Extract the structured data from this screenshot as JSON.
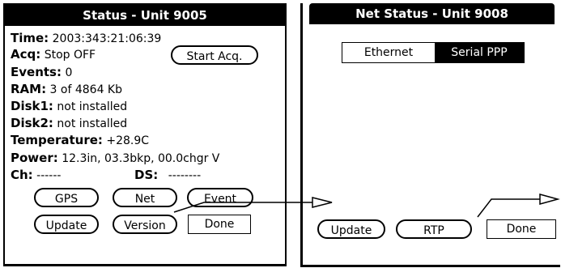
{
  "left_window": {
    "title": "Status - Unit 9005",
    "time_label": "Time:",
    "time_value": "2003:343:21:06:39",
    "acq_label": "Acq:",
    "acq_value": "Stop OFF",
    "start_acq_button": "Start Acq.",
    "events_label": "Events:",
    "events_value": "0",
    "ram_label": "RAM:",
    "ram_value": "3 of 4864 Kb",
    "disk1_label": "Disk1:",
    "disk1_value": "not installed",
    "disk2_label": "Disk2:",
    "disk2_value": "not installed",
    "temperature_label": "Temperature:",
    "temperature_value": "+28.9C",
    "power_label": "Power:",
    "power_value": "12.3in, 03.3bkp, 00.0chgr V",
    "ch_label": "Ch:",
    "ch_value": "------",
    "ds_label": "DS:",
    "ds_value": "--------",
    "buttons": {
      "gps": "GPS",
      "net": "Net",
      "event": "Event",
      "update": "Update",
      "version": "Version",
      "done": "Done"
    }
  },
  "right_window": {
    "title": "Net Status - Unit 9008",
    "tabs": {
      "ethernet": "Ethernet",
      "serial_ppp": "Serial PPP"
    },
    "selected_tab": "Serial PPP",
    "buttons": {
      "update": "Update",
      "rtp": "RTP",
      "done": "Done"
    }
  }
}
